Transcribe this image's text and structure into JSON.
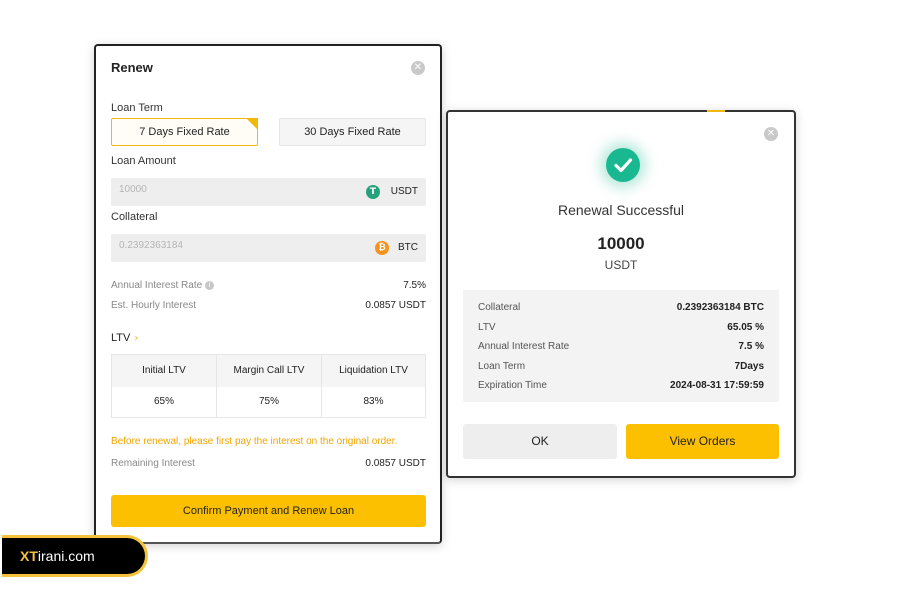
{
  "renew_dialog": {
    "title": "Renew",
    "loan_term_label": "Loan Term",
    "terms": [
      "7 Days Fixed Rate",
      "30 Days Fixed Rate"
    ],
    "selected_term": "7 Days Fixed Rate",
    "loan_amount_label": "Loan Amount",
    "loan_amount_value": "10000",
    "loan_amount_unit": "USDT",
    "collateral_label": "Collateral",
    "collateral_value": "0.2392363184",
    "collateral_unit": "BTC",
    "annual_interest_rate_label": "Annual Interest Rate",
    "annual_interest_rate_value": "7.5%",
    "est_hourly_interest_label": "Est. Hourly Interest",
    "est_hourly_interest_value": "0.0857 USDT",
    "ltv_label": "LTV",
    "ltv_headers": [
      "Initial LTV",
      "Margin Call LTV",
      "Liquidation LTV"
    ],
    "ltv_values": [
      "65%",
      "75%",
      "83%"
    ],
    "warning": "Before renewal, please first pay the interest on the original order.",
    "remaining_interest_label": "Remaining Interest",
    "remaining_interest_value": "0.0857 USDT",
    "confirm_button": "Confirm Payment and Renew Loan"
  },
  "success_dialog": {
    "title": "Renewal Successful",
    "amount": "10000",
    "amount_unit": "USDT",
    "details": [
      {
        "label": "Collateral",
        "value": "0.2392363184 BTC"
      },
      {
        "label": "LTV",
        "value": "65.05 %"
      },
      {
        "label": "Annual Interest Rate",
        "value": "7.5 %"
      },
      {
        "label": "Loan Term",
        "value": "7Days"
      },
      {
        "label": "Expiration Time",
        "value": "2024-08-31 17:59:59"
      }
    ],
    "ok_button": "OK",
    "view_orders_button": "View Orders"
  },
  "watermark": {
    "prefix": "XT",
    "suffix": "irani.com"
  },
  "colors": {
    "accent": "#fcc000",
    "accent_border": "#f0b90b",
    "success": "#19b890",
    "usdt_icon": "#26a17b",
    "btc_icon": "#f7931a",
    "warning_text": "#f0a500"
  },
  "icons": {
    "close": "close-icon",
    "usdt": "usdt-icon",
    "btc": "btc-icon",
    "success": "check-circle-icon",
    "info": "info-icon",
    "chevron": "chevron-right-icon"
  }
}
